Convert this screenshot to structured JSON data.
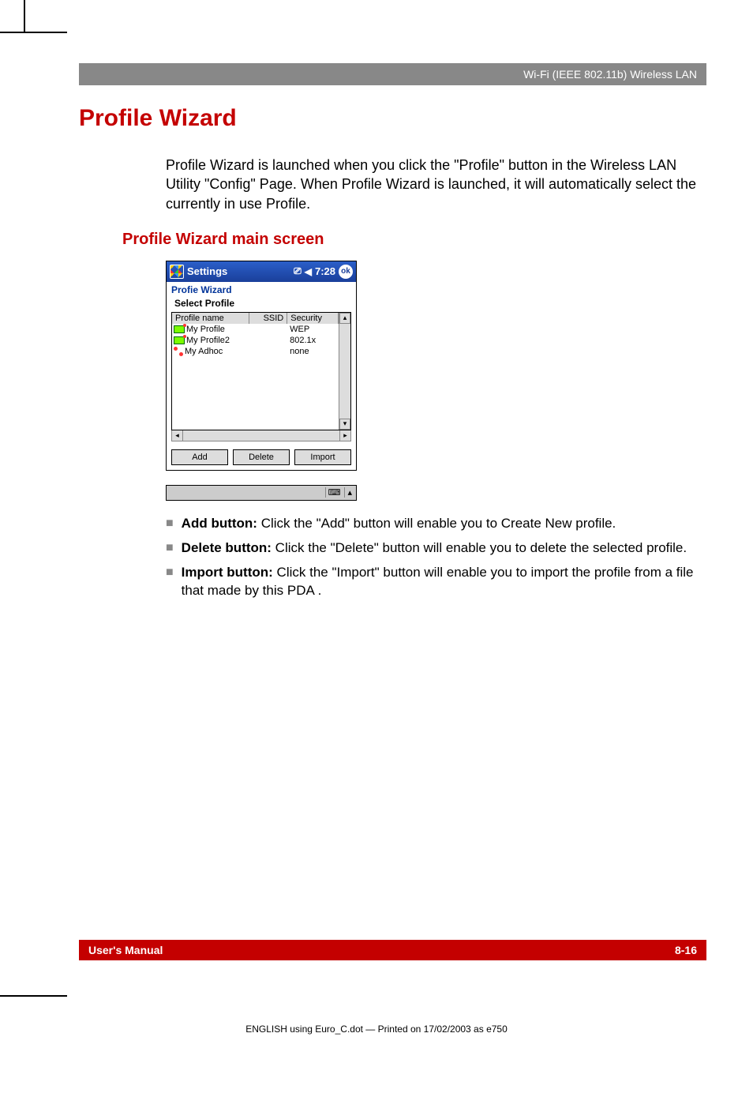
{
  "header": {
    "right_text": "Wi-Fi (IEEE 802.11b) Wireless LAN"
  },
  "h1": "Profile Wizard",
  "intro": "Profile Wizard is launched when you click the \"Profile\" button in the Wireless LAN Utility \"Config\" Page. When Profile Wizard is launched, it will automatically select the currently in use Profile.",
  "h2": "Profile Wizard main screen",
  "pda": {
    "titlebar": {
      "title": "Settings",
      "time": "7:28",
      "ok": "ok"
    },
    "app_title": "Profie Wizard",
    "subheader": "Select Profile",
    "columns": {
      "name": "Profile name",
      "ssid": "SSID",
      "security": "Security"
    },
    "rows": [
      {
        "name": "My Profile",
        "ssid": "",
        "security": "WEP",
        "icon": "net"
      },
      {
        "name": "My Profile2",
        "ssid": "",
        "security": "802.1x",
        "icon": "net"
      },
      {
        "name": "My Adhoc",
        "ssid": "",
        "security": "none",
        "icon": "adhoc"
      }
    ],
    "buttons": {
      "add": "Add",
      "delete": "Delete",
      "import": "Import"
    }
  },
  "bullets": [
    {
      "label": "Add button:",
      "text": " Click the \"Add\" button will enable you to Create New profile."
    },
    {
      "label": "Delete button:",
      "text": " Click the \"Delete\" button will enable you to delete the selected profile."
    },
    {
      "label": "Import button:",
      "text": " Click the \"Import\" button will enable you to import the profile from a file that made by this PDA ."
    }
  ],
  "footer": {
    "left": "User's Manual",
    "right": "8-16"
  },
  "printline": "ENGLISH using Euro_C.dot — Printed on 17/02/2003 as e750"
}
